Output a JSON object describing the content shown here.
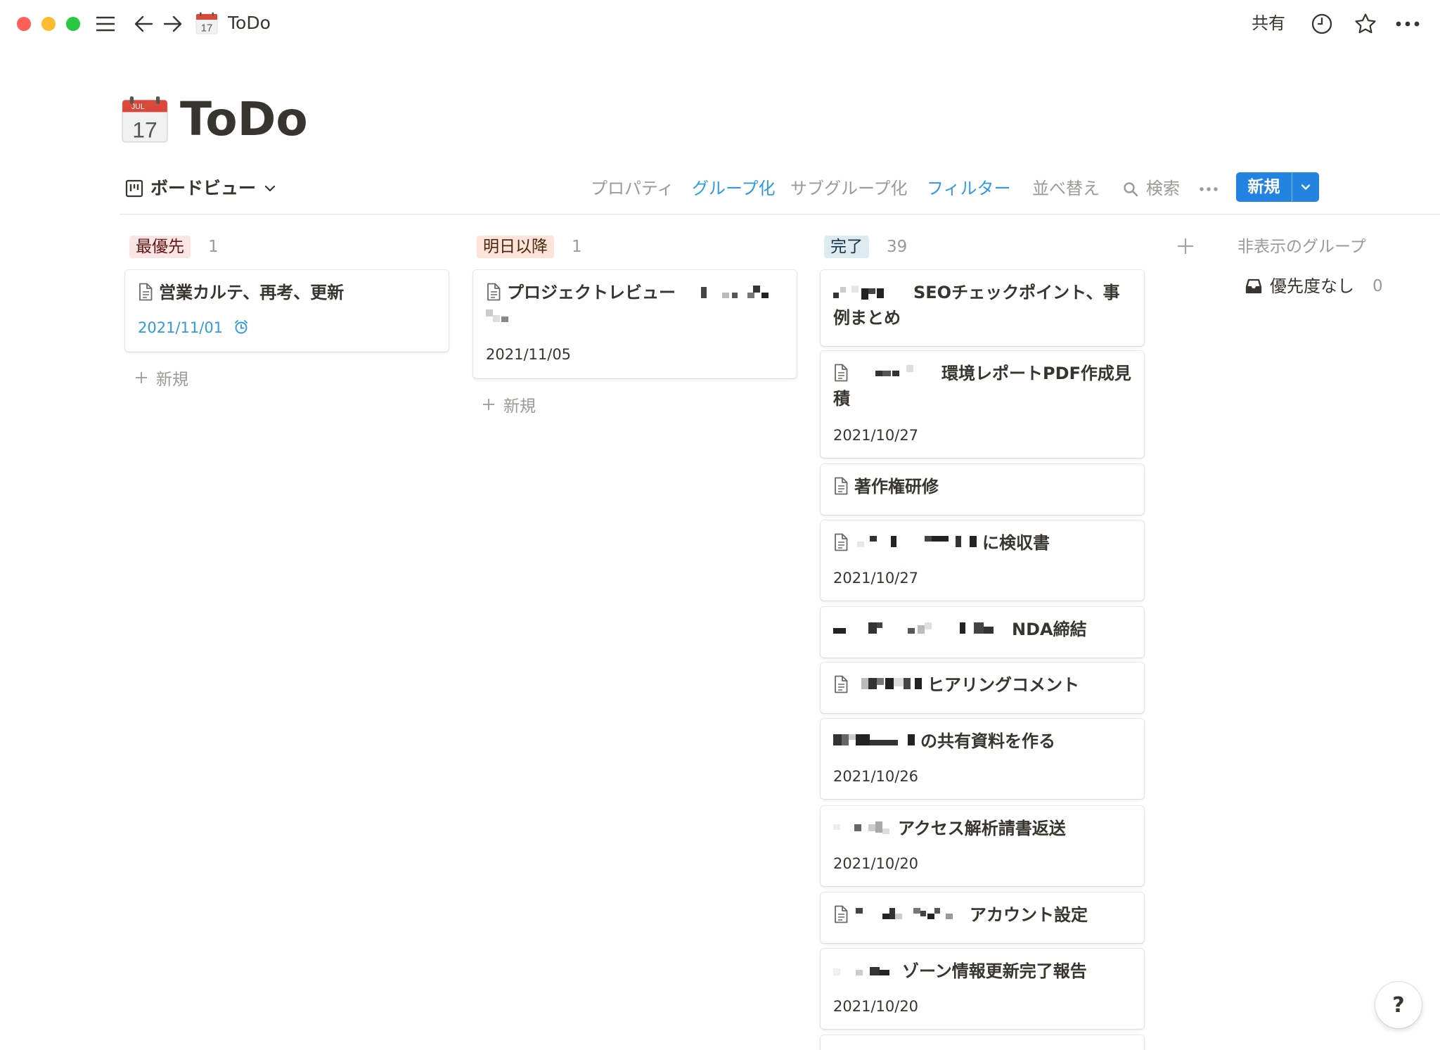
{
  "window": {
    "title": "ToDo",
    "share_label": "共有"
  },
  "page": {
    "title": "ToDo",
    "calendar_month": "JUL",
    "calendar_day": "17"
  },
  "toolbar": {
    "view_label": "ボードビュー",
    "properties": "プロパティ",
    "group": "グループ化",
    "subgroup": "サブグループ化",
    "filter": "フィルター",
    "sort": "並べ替え",
    "search": "検索",
    "new_label": "新規"
  },
  "columns": [
    {
      "name": "最優先",
      "count": "1",
      "tag_bg": "#fbe4e4",
      "tag_color": "#5d1715",
      "cards": [
        {
          "title": "営業カルテ、再考、更新",
          "date": "2021/11/01"
        }
      ],
      "add_label": "新規"
    },
    {
      "name": "明日以降",
      "count": "1",
      "tag_bg": "#fde3d9",
      "tag_color": "#49290e",
      "cards": [
        {
          "title": "プロジェクトレビュー",
          "date": "2021/11/05"
        }
      ],
      "add_label": "新規"
    },
    {
      "name": "完了",
      "count": "39",
      "tag_bg": "#ddebf1",
      "tag_color": "#183347",
      "cards": [
        {
          "title": "SEOチェックポイント、事例まとめ"
        },
        {
          "title": "環境レポートPDF作成見積",
          "date": "2021/10/27"
        },
        {
          "title": "著作権研修"
        },
        {
          "title": "に検収書",
          "date": "2021/10/27"
        },
        {
          "title": "NDA締結"
        },
        {
          "title": "ヒアリングコメント"
        },
        {
          "title": "の共有資料を作る",
          "date": "2021/10/26"
        },
        {
          "title": "アクセス解析請書返送",
          "date": "2021/10/20"
        },
        {
          "title": "アカウント設定"
        },
        {
          "title": "ゾーン情報更新完了報告",
          "date": "2021/10/20"
        }
      ]
    }
  ],
  "hidden_groups": {
    "title": "非表示のグループ",
    "items": [
      {
        "label": "優先度なし",
        "count": "0"
      }
    ]
  },
  "help_label": "?"
}
